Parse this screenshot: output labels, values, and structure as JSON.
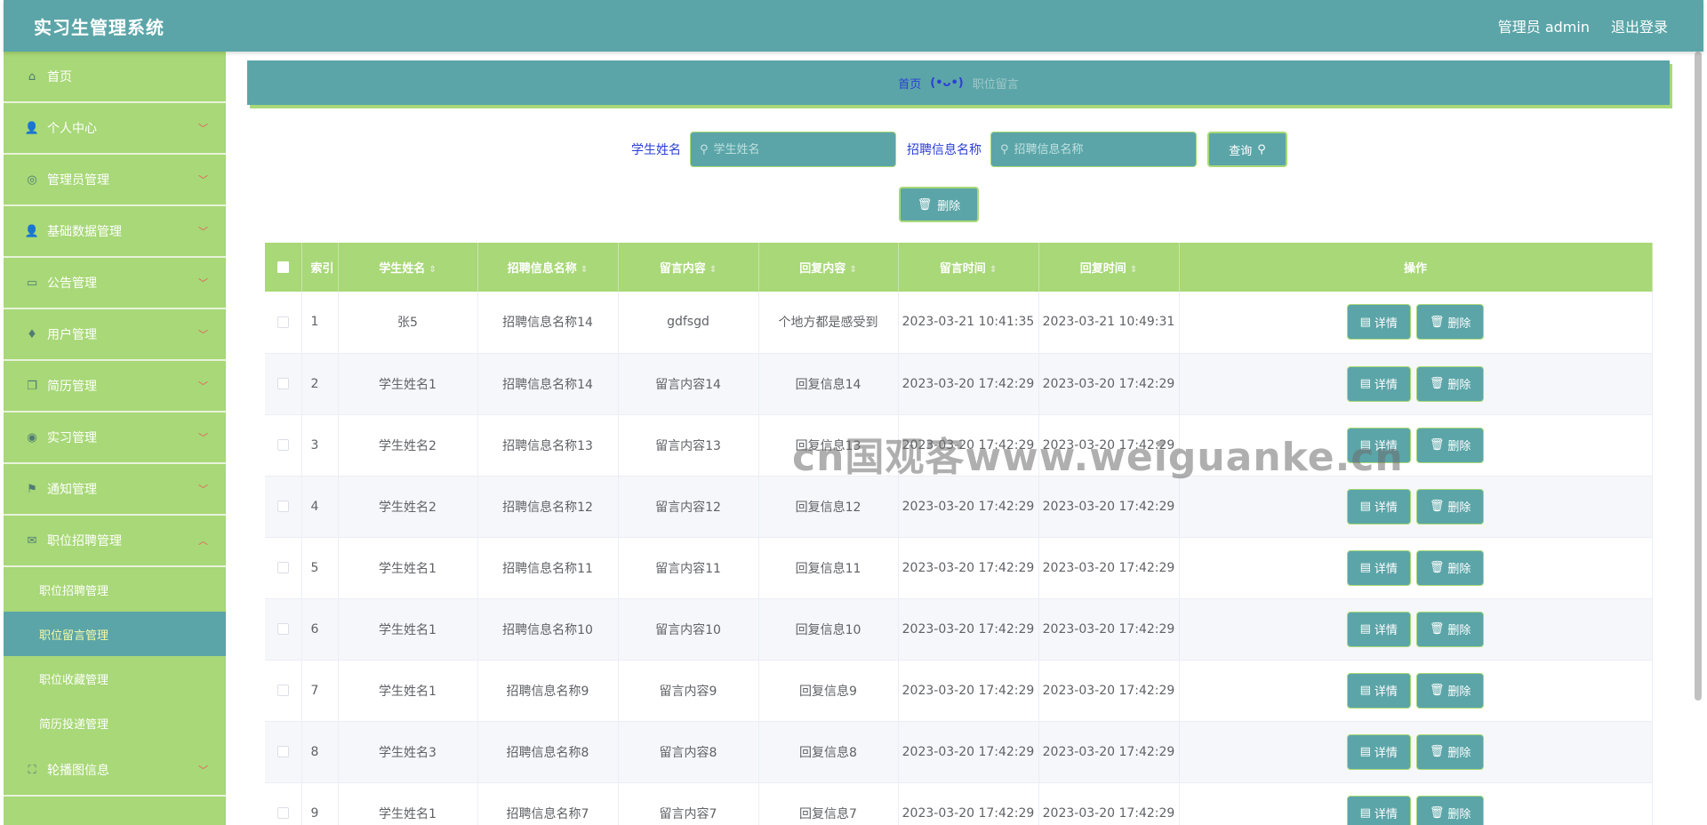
{
  "header": {
    "title": "实习生管理系统",
    "user_label": "管理员 admin",
    "logout_label": "退出登录"
  },
  "sidebar": {
    "items": [
      {
        "label": "首页",
        "icon": "home-icon",
        "glyph": "⌂",
        "has_chevron": false
      },
      {
        "label": "个人中心",
        "icon": "user-icon",
        "glyph": "👤",
        "has_chevron": true
      },
      {
        "label": "管理员管理",
        "icon": "compass-icon",
        "glyph": "◎",
        "has_chevron": true
      },
      {
        "label": "基础数据管理",
        "icon": "user-icon",
        "glyph": "👤",
        "has_chevron": true
      },
      {
        "label": "公告管理",
        "icon": "chat-icon",
        "glyph": "▭",
        "has_chevron": true
      },
      {
        "label": "用户管理",
        "icon": "microphone-icon",
        "glyph": "♦",
        "has_chevron": true
      },
      {
        "label": "简历管理",
        "icon": "copy-icon",
        "glyph": "❐",
        "has_chevron": true
      },
      {
        "label": "实习管理",
        "icon": "target-icon",
        "glyph": "◉",
        "has_chevron": true
      },
      {
        "label": "通知管理",
        "icon": "flag-icon",
        "glyph": "⚑",
        "has_chevron": true
      },
      {
        "label": "职位招聘管理",
        "icon": "mail-icon",
        "glyph": "✉",
        "has_chevron": true,
        "expanded": true
      }
    ],
    "submenu": [
      "职位招聘管理",
      "职位留言管理",
      "职位收藏管理",
      "简历投递管理"
    ],
    "active_sub": 1,
    "last_item": {
      "label": "轮播图信息",
      "icon": "fullscreen-icon",
      "glyph": "⛶"
    }
  },
  "breadcrumb": {
    "home": "首页",
    "separator": "(•ᴗ•)",
    "current": "职位留言"
  },
  "search": {
    "field1_label": "学生姓名",
    "field1_placeholder": "学生姓名",
    "field2_label": "招聘信息名称",
    "field2_placeholder": "招聘信息名称",
    "query_label": "查询"
  },
  "delete_label": "删除",
  "table": {
    "columns": [
      "索引",
      "学生姓名",
      "招聘信息名称",
      "留言内容",
      "回复内容",
      "留言时间",
      "回复时间",
      "操作"
    ],
    "detail_label": "详情",
    "delete_label": "删除",
    "rows": [
      [
        "1",
        "张5",
        "招聘信息名称14",
        "gdfsgd",
        "个地方都是感受到",
        "2023-03-21 10:41:35",
        "2023-03-21 10:49:31"
      ],
      [
        "2",
        "学生姓名1",
        "招聘信息名称14",
        "留言内容14",
        "回复信息14",
        "2023-03-20 17:42:29",
        "2023-03-20 17:42:29"
      ],
      [
        "3",
        "学生姓名2",
        "招聘信息名称13",
        "留言内容13",
        "回复信息13",
        "2023-03-20 17:42:29",
        "2023-03-20 17:42:29"
      ],
      [
        "4",
        "学生姓名2",
        "招聘信息名称12",
        "留言内容12",
        "回复信息12",
        "2023-03-20 17:42:29",
        "2023-03-20 17:42:29"
      ],
      [
        "5",
        "学生姓名1",
        "招聘信息名称11",
        "留言内容11",
        "回复信息11",
        "2023-03-20 17:42:29",
        "2023-03-20 17:42:29"
      ],
      [
        "6",
        "学生姓名1",
        "招聘信息名称10",
        "留言内容10",
        "回复信息10",
        "2023-03-20 17:42:29",
        "2023-03-20 17:42:29"
      ],
      [
        "7",
        "学生姓名1",
        "招聘信息名称9",
        "留言内容9",
        "回复信息9",
        "2023-03-20 17:42:29",
        "2023-03-20 17:42:29"
      ],
      [
        "8",
        "学生姓名3",
        "招聘信息名称8",
        "留言内容8",
        "回复信息8",
        "2023-03-20 17:42:29",
        "2023-03-20 17:42:29"
      ],
      [
        "9",
        "学生姓名1",
        "招聘信息名称7",
        "留言内容7",
        "回复信息7",
        "2023-03-20 17:42:29",
        "2023-03-20 17:42:29"
      ]
    ]
  },
  "watermark": "cn国观客www.weiguanke.cn",
  "colors": {
    "primary": "#5ba5a8",
    "accent": "#a8d877",
    "link": "#2b3fd6"
  }
}
